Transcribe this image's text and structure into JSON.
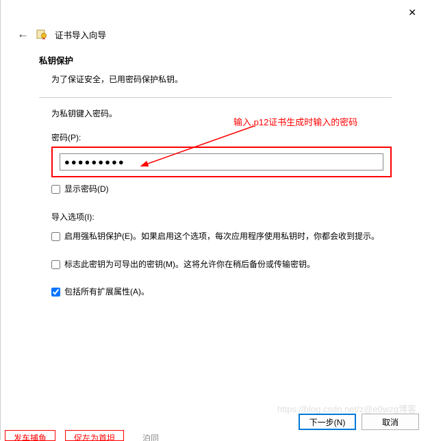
{
  "header": {
    "title": "证书导入向导"
  },
  "section": {
    "title": "私钥保护",
    "subtitle": "为了保证安全，已用密码保护私钥。"
  },
  "instruction": "为私钥键入密码。",
  "password": {
    "label": "密码(P):",
    "value": "●●●●●●●●●",
    "show_label": "显示密码(D)"
  },
  "annotation": "输入.p12证书生成时输入的密码",
  "import": {
    "label": "导入选项(I):",
    "opt1": "启用强私钥保护(E)。如果启用这个选项，每次应用程序使用私钥时，你都会收到提示。",
    "opt2": "标志此密钥为可导出的密钥(M)。这将允许你在稍后备份或传输密钥。",
    "opt3": "包括所有扩展属性(A)。"
  },
  "buttons": {
    "next": "下一步(N)",
    "cancel": "取消"
  },
  "watermark": "https://blog.csdn.net/z@e0wzg博客",
  "bottom_hints": {
    "a": "发车捕鱼",
    "b": "促左为首坦",
    "c": "泊同"
  }
}
